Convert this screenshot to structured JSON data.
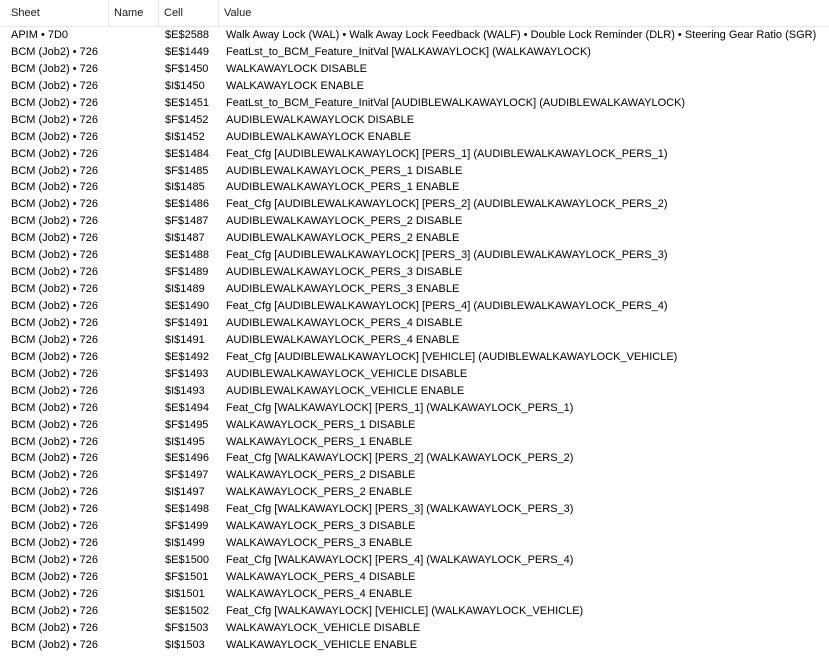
{
  "columns": {
    "sheet": "Sheet",
    "name": "Name",
    "cell": "Cell",
    "value": "Value"
  },
  "rows": [
    {
      "sheet": "APIM • 7D0",
      "name": "",
      "cell": "$E$2588",
      "value": "Walk Away Lock (WAL) • Walk Away Lock Feedback (WALF) • Double Lock Reminder (DLR) • Steering Gear Ratio (SGR)"
    },
    {
      "sheet": "BCM (Job2) • 726",
      "name": "",
      "cell": "$E$1449",
      "value": "FeatLst_to_BCM_Feature_InitVal [WALKAWAYLOCK] (WALKAWAYLOCK)"
    },
    {
      "sheet": "BCM (Job2) • 726",
      "name": "",
      "cell": "$F$1450",
      "value": "WALKAWAYLOCK DISABLE"
    },
    {
      "sheet": "BCM (Job2) • 726",
      "name": "",
      "cell": "$I$1450",
      "value": "WALKAWAYLOCK ENABLE"
    },
    {
      "sheet": "BCM (Job2) • 726",
      "name": "",
      "cell": "$E$1451",
      "value": "FeatLst_to_BCM_Feature_InitVal [AUDIBLEWALKAWAYLOCK]  (AUDIBLEWALKAWAYLOCK)"
    },
    {
      "sheet": "BCM (Job2) • 726",
      "name": "",
      "cell": "$F$1452",
      "value": "AUDIBLEWALKAWAYLOCK DISABLE"
    },
    {
      "sheet": "BCM (Job2) • 726",
      "name": "",
      "cell": "$I$1452",
      "value": "AUDIBLEWALKAWAYLOCK ENABLE"
    },
    {
      "sheet": "BCM (Job2) • 726",
      "name": "",
      "cell": "$E$1484",
      "value": "Feat_Cfg [AUDIBLEWALKAWAYLOCK] [PERS_1] (AUDIBLEWALKAWAYLOCK_PERS_1)"
    },
    {
      "sheet": "BCM (Job2) • 726",
      "name": "",
      "cell": "$F$1485",
      "value": "AUDIBLEWALKAWAYLOCK_PERS_1 DISABLE"
    },
    {
      "sheet": "BCM (Job2) • 726",
      "name": "",
      "cell": "$I$1485",
      "value": "AUDIBLEWALKAWAYLOCK_PERS_1 ENABLE"
    },
    {
      "sheet": "BCM (Job2) • 726",
      "name": "",
      "cell": "$E$1486",
      "value": "Feat_Cfg [AUDIBLEWALKAWAYLOCK] [PERS_2] (AUDIBLEWALKAWAYLOCK_PERS_2)"
    },
    {
      "sheet": "BCM (Job2) • 726",
      "name": "",
      "cell": "$F$1487",
      "value": "AUDIBLEWALKAWAYLOCK_PERS_2 DISABLE"
    },
    {
      "sheet": "BCM (Job2) • 726",
      "name": "",
      "cell": "$I$1487",
      "value": "AUDIBLEWALKAWAYLOCK_PERS_2 ENABLE"
    },
    {
      "sheet": "BCM (Job2) • 726",
      "name": "",
      "cell": "$E$1488",
      "value": "Feat_Cfg [AUDIBLEWALKAWAYLOCK] [PERS_3] (AUDIBLEWALKAWAYLOCK_PERS_3)"
    },
    {
      "sheet": "BCM (Job2) • 726",
      "name": "",
      "cell": "$F$1489",
      "value": "AUDIBLEWALKAWAYLOCK_PERS_3 DISABLE"
    },
    {
      "sheet": "BCM (Job2) • 726",
      "name": "",
      "cell": "$I$1489",
      "value": "AUDIBLEWALKAWAYLOCK_PERS_3 ENABLE"
    },
    {
      "sheet": "BCM (Job2) • 726",
      "name": "",
      "cell": "$E$1490",
      "value": "Feat_Cfg [AUDIBLEWALKAWAYLOCK] [PERS_4] (AUDIBLEWALKAWAYLOCK_PERS_4)"
    },
    {
      "sheet": "BCM (Job2) • 726",
      "name": "",
      "cell": "$F$1491",
      "value": "AUDIBLEWALKAWAYLOCK_PERS_4 DISABLE"
    },
    {
      "sheet": "BCM (Job2) • 726",
      "name": "",
      "cell": "$I$1491",
      "value": "AUDIBLEWALKAWAYLOCK_PERS_4 ENABLE"
    },
    {
      "sheet": "BCM (Job2) • 726",
      "name": "",
      "cell": "$E$1492",
      "value": "Feat_Cfg [AUDIBLEWALKAWAYLOCK] [VEHICLE] (AUDIBLEWALKAWAYLOCK_VEHICLE)"
    },
    {
      "sheet": "BCM (Job2) • 726",
      "name": "",
      "cell": "$F$1493",
      "value": "AUDIBLEWALKAWAYLOCK_VEHICLE DISABLE"
    },
    {
      "sheet": "BCM (Job2) • 726",
      "name": "",
      "cell": "$I$1493",
      "value": "AUDIBLEWALKAWAYLOCK_VEHICLE ENABLE"
    },
    {
      "sheet": "BCM (Job2) • 726",
      "name": "",
      "cell": "$E$1494",
      "value": "Feat_Cfg [WALKAWAYLOCK] [PERS_1] (WALKAWAYLOCK_PERS_1)"
    },
    {
      "sheet": "BCM (Job2) • 726",
      "name": "",
      "cell": "$F$1495",
      "value": "WALKAWAYLOCK_PERS_1 DISABLE"
    },
    {
      "sheet": "BCM (Job2) • 726",
      "name": "",
      "cell": "$I$1495",
      "value": "WALKAWAYLOCK_PERS_1 ENABLE"
    },
    {
      "sheet": "BCM (Job2) • 726",
      "name": "",
      "cell": "$E$1496",
      "value": "Feat_Cfg [WALKAWAYLOCK] [PERS_2] (WALKAWAYLOCK_PERS_2)"
    },
    {
      "sheet": "BCM (Job2) • 726",
      "name": "",
      "cell": "$F$1497",
      "value": "WALKAWAYLOCK_PERS_2 DISABLE"
    },
    {
      "sheet": "BCM (Job2) • 726",
      "name": "",
      "cell": "$I$1497",
      "value": "WALKAWAYLOCK_PERS_2 ENABLE"
    },
    {
      "sheet": "BCM (Job2) • 726",
      "name": "",
      "cell": "$E$1498",
      "value": "Feat_Cfg [WALKAWAYLOCK] [PERS_3] (WALKAWAYLOCK_PERS_3)"
    },
    {
      "sheet": "BCM (Job2) • 726",
      "name": "",
      "cell": "$F$1499",
      "value": "WALKAWAYLOCK_PERS_3 DISABLE"
    },
    {
      "sheet": "BCM (Job2) • 726",
      "name": "",
      "cell": "$I$1499",
      "value": "WALKAWAYLOCK_PERS_3 ENABLE"
    },
    {
      "sheet": "BCM (Job2) • 726",
      "name": "",
      "cell": "$E$1500",
      "value": "Feat_Cfg [WALKAWAYLOCK] [PERS_4] (WALKAWAYLOCK_PERS_4)"
    },
    {
      "sheet": "BCM (Job2) • 726",
      "name": "",
      "cell": "$F$1501",
      "value": "WALKAWAYLOCK_PERS_4 DISABLE"
    },
    {
      "sheet": "BCM (Job2) • 726",
      "name": "",
      "cell": "$I$1501",
      "value": "WALKAWAYLOCK_PERS_4 ENABLE"
    },
    {
      "sheet": "BCM (Job2) • 726",
      "name": "",
      "cell": "$E$1502",
      "value": "Feat_Cfg [WALKAWAYLOCK] [VEHICLE] (WALKAWAYLOCK_VEHICLE)"
    },
    {
      "sheet": "BCM (Job2) • 726",
      "name": "",
      "cell": "$F$1503",
      "value": "WALKAWAYLOCK_VEHICLE DISABLE"
    },
    {
      "sheet": "BCM (Job2) • 726",
      "name": "",
      "cell": "$I$1503",
      "value": "WALKAWAYLOCK_VEHICLE ENABLE"
    }
  ]
}
